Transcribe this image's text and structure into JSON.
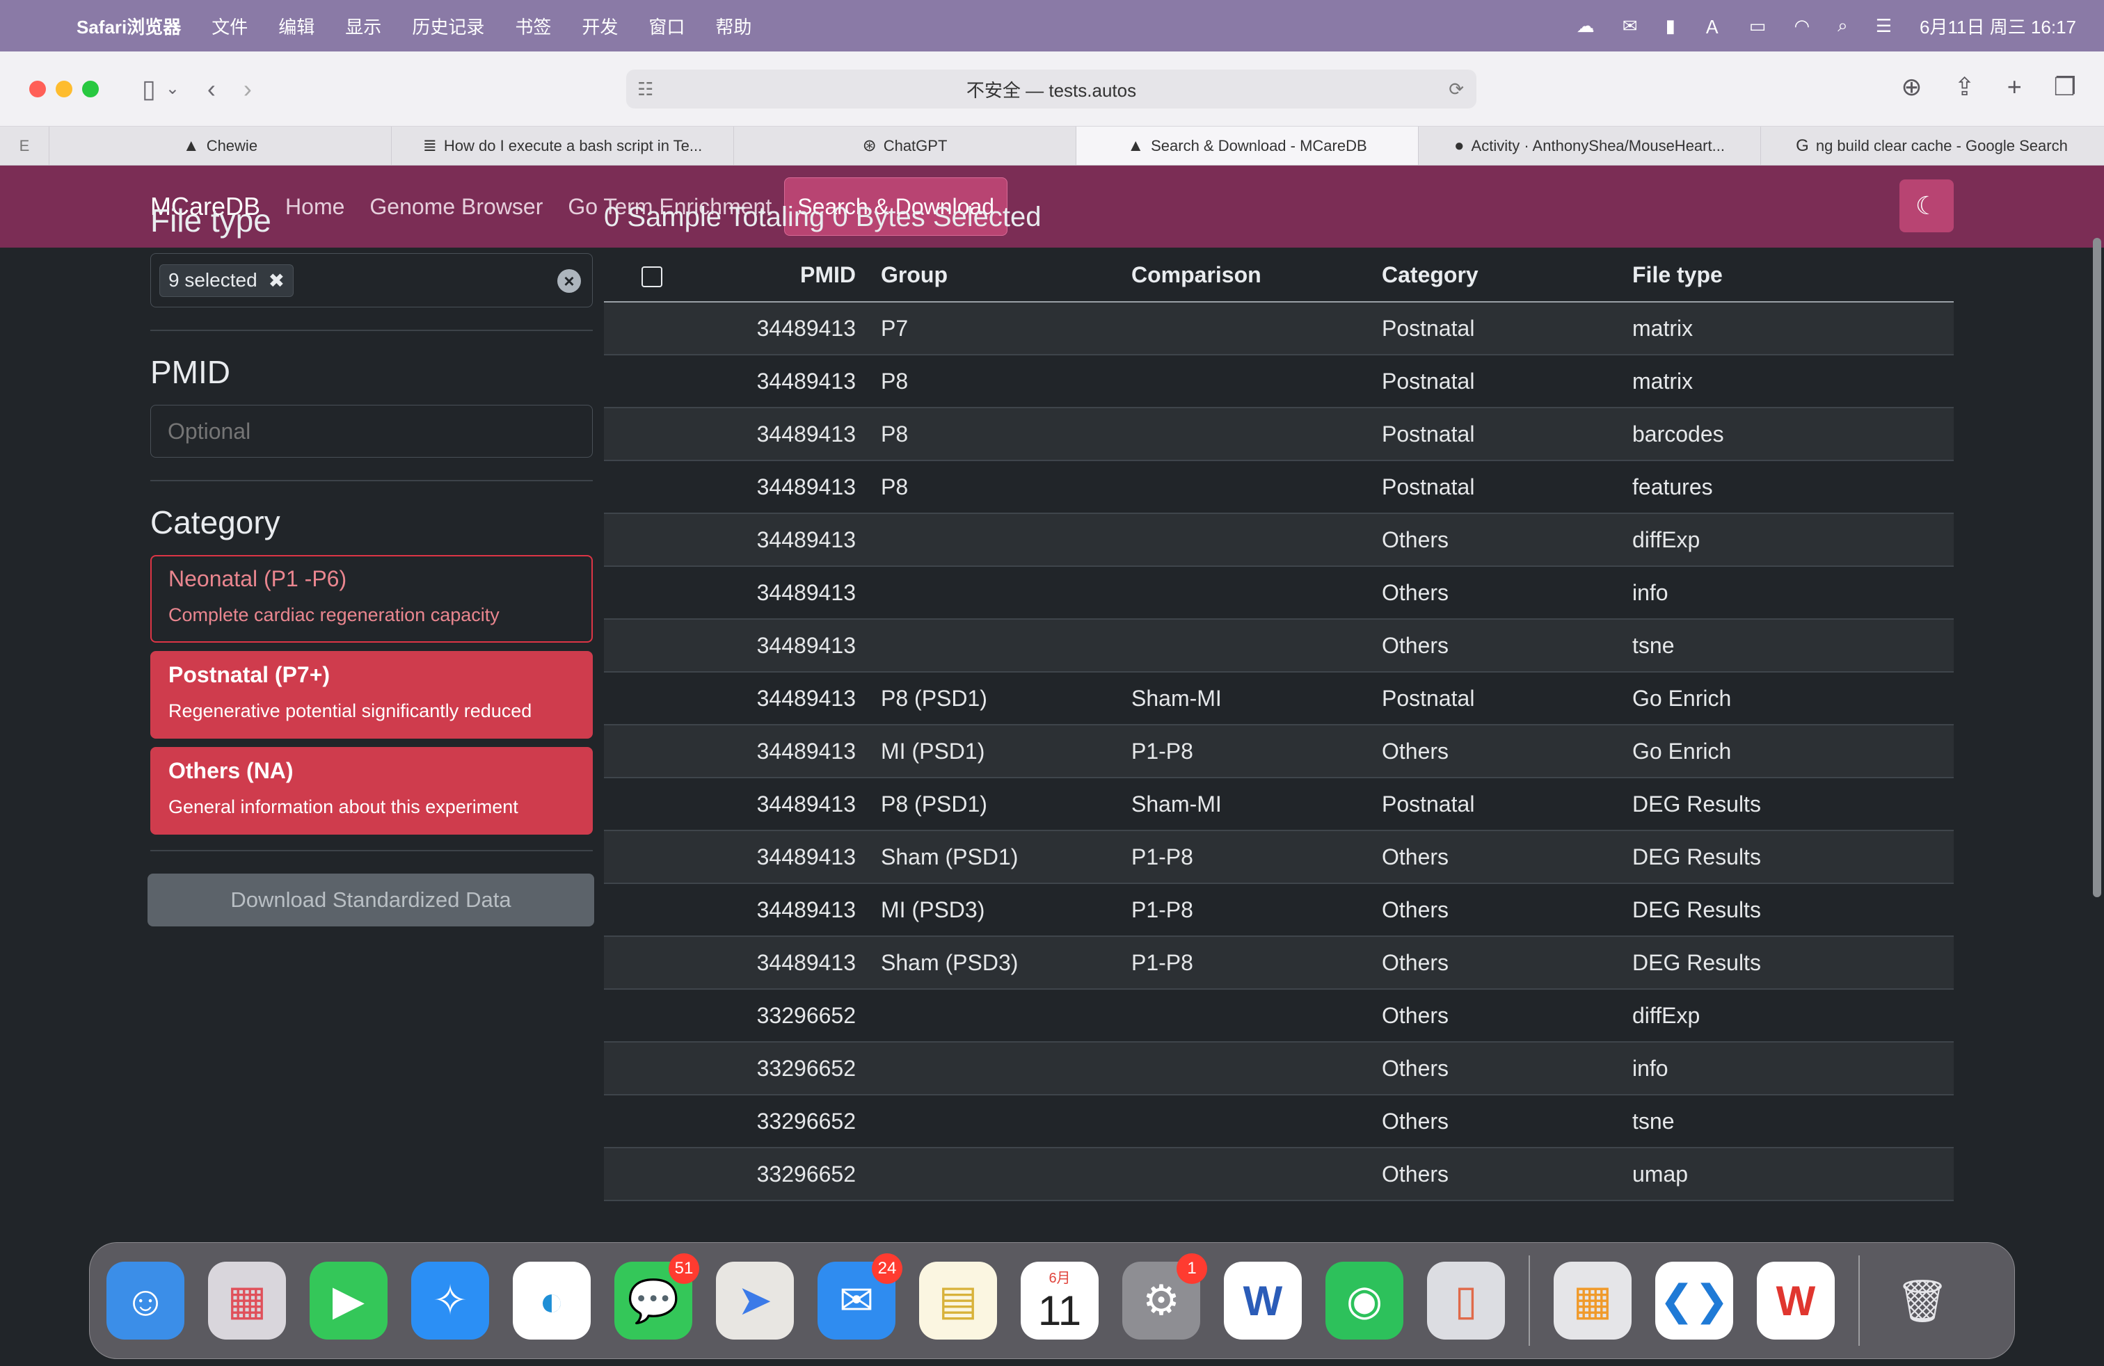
{
  "menubar": {
    "app_name": "Safari浏览器",
    "items": [
      "文件",
      "编辑",
      "显示",
      "历史记录",
      "书签",
      "开发",
      "窗口",
      "帮助"
    ],
    "datetime": "6月11日 周三 16:17"
  },
  "browser": {
    "url": "不安全 — tests.autos",
    "tabs": [
      {
        "label": "Chewie"
      },
      {
        "label": "How do I execute a bash script in Te..."
      },
      {
        "label": "ChatGPT"
      },
      {
        "label": "Search & Download - MCareDB"
      },
      {
        "label": "Activity · AnthonyShea/MouseHeart..."
      },
      {
        "label": "ng build clear cache - Google Search"
      }
    ]
  },
  "navbar": {
    "brand": "MCareDB",
    "links": [
      "Home",
      "Genome Browser",
      "Go Term Enrichment",
      "Search & Download"
    ]
  },
  "sidebar": {
    "file_type_heading": "File type",
    "file_type_chip": "9 selected",
    "pmid_heading": "PMID",
    "pmid_placeholder": "Optional",
    "category_heading": "Category",
    "categories": [
      {
        "title": "Neonatal (P1 -P6)",
        "desc": "Complete cardiac regeneration capacity"
      },
      {
        "title": "Postnatal (P7+)",
        "desc": "Regenerative potential significantly reduced"
      },
      {
        "title": "Others (NA)",
        "desc": "General information about this experiment"
      }
    ],
    "download_label": "Download Standardized Data"
  },
  "main": {
    "summary": "0 Sample Totaling 0 Bytes Selected",
    "headers": [
      "PMID",
      "Group",
      "Comparison",
      "Category",
      "File type"
    ],
    "rows": [
      [
        "34489413",
        "P7",
        "",
        "Postnatal",
        "matrix"
      ],
      [
        "34489413",
        "P8",
        "",
        "Postnatal",
        "matrix"
      ],
      [
        "34489413",
        "P8",
        "",
        "Postnatal",
        "barcodes"
      ],
      [
        "34489413",
        "P8",
        "",
        "Postnatal",
        "features"
      ],
      [
        "34489413",
        "",
        "",
        "Others",
        "diffExp"
      ],
      [
        "34489413",
        "",
        "",
        "Others",
        "info"
      ],
      [
        "34489413",
        "",
        "",
        "Others",
        "tsne"
      ],
      [
        "34489413",
        "P8 (PSD1)",
        "Sham-MI",
        "Postnatal",
        "Go Enrich"
      ],
      [
        "34489413",
        "MI (PSD1)",
        "P1-P8",
        "Others",
        "Go Enrich"
      ],
      [
        "34489413",
        "P8 (PSD1)",
        "Sham-MI",
        "Postnatal",
        "DEG Results"
      ],
      [
        "34489413",
        "Sham (PSD1)",
        "P1-P8",
        "Others",
        "DEG Results"
      ],
      [
        "34489413",
        "MI (PSD3)",
        "P1-P8",
        "Others",
        "DEG Results"
      ],
      [
        "34489413",
        "Sham (PSD3)",
        "P1-P8",
        "Others",
        "DEG Results"
      ],
      [
        "33296652",
        "",
        "",
        "Others",
        "diffExp"
      ],
      [
        "33296652",
        "",
        "",
        "Others",
        "info"
      ],
      [
        "33296652",
        "",
        "",
        "Others",
        "tsne"
      ],
      [
        "33296652",
        "",
        "",
        "Others",
        "umap"
      ]
    ]
  },
  "dock": {
    "badges": {
      "messages": "51",
      "mail": "24",
      "settings": "1"
    },
    "calendar": {
      "month": "6月",
      "day": "11"
    }
  },
  "colors": {
    "navbar": "#7b2d55",
    "accent": "#b84472",
    "danger": "#dc3545"
  }
}
